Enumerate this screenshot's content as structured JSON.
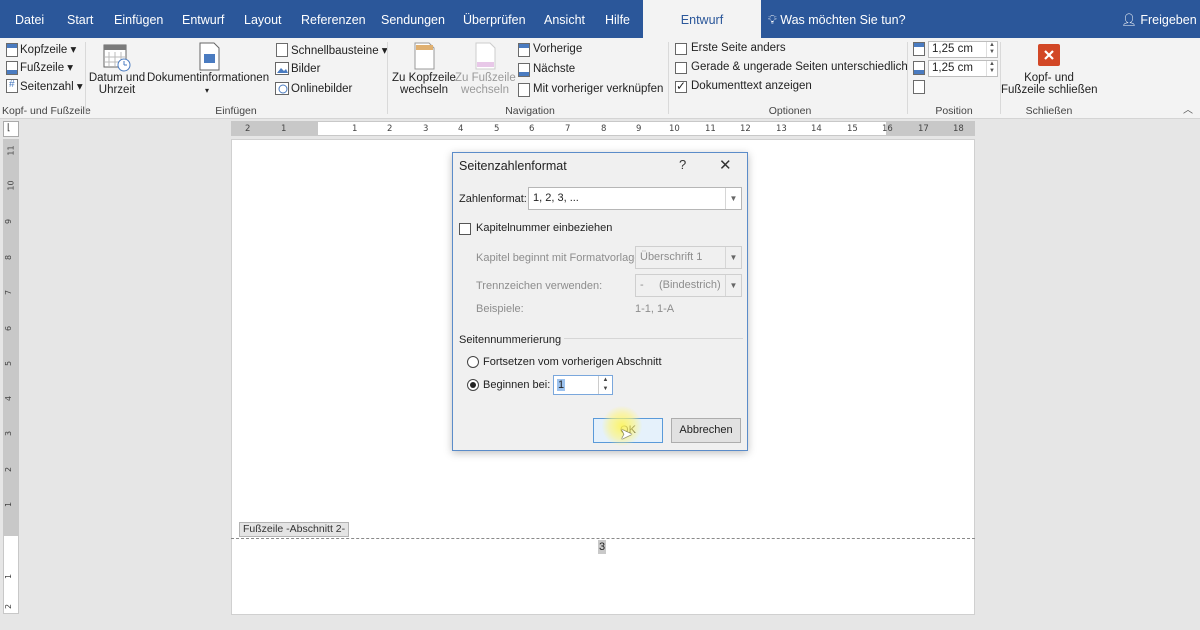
{
  "ribbon_tabs": [
    "Datei",
    "Start",
    "Einfügen",
    "Entwurf",
    "Layout",
    "Referenzen",
    "Sendungen",
    "Überprüfen",
    "Ansicht",
    "Hilfe"
  ],
  "active_tab": "Entwurf",
  "tell_me": "Was möchten Sie tun?",
  "share": "Freigeben",
  "groups": {
    "kopf": {
      "kopfzeile": "Kopfzeile",
      "fusszeile": "Fußzeile",
      "seitenzahl": "Seitenzahl",
      "label": "Kopf- und Fußzeile"
    },
    "einfuegen": {
      "datum_line1": "Datum und",
      "datum_line2": "Uhrzeit",
      "dokinfo": "Dokumentinformationen",
      "schnellbausteine": "Schnellbausteine",
      "bilder": "Bilder",
      "onlinebilder": "Onlinebilder",
      "label": "Einfügen"
    },
    "navigation": {
      "zu_kopf_line1": "Zu Kopfzeile",
      "zu_kopf_line2": "wechseln",
      "zu_fuss_line1": "Zu Fußzeile",
      "zu_fuss_line2": "wechseln",
      "vorherige": "Vorherige",
      "naechste": "Nächste",
      "verknuepfen": "Mit vorheriger verknüpfen",
      "label": "Navigation"
    },
    "optionen": {
      "erste_seite": "Erste Seite anders",
      "gerade": "Gerade & ungerade Seiten unterschiedlich",
      "doktext": "Dokumenttext anzeigen",
      "erste_checked": false,
      "gerade_checked": false,
      "doktext_checked": true,
      "label": "Optionen"
    },
    "position": {
      "top_value": "1,25 cm",
      "bottom_value": "1,25 cm",
      "label": "Position"
    },
    "schliessen": {
      "line1": "Kopf- und",
      "line2": "Fußzeile schließen",
      "label": "Schließen"
    }
  },
  "hruler_ticks": [
    "2",
    "1",
    "1",
    "2",
    "3",
    "4",
    "5",
    "6",
    "7",
    "8",
    "9",
    "10",
    "11",
    "12",
    "13",
    "14",
    "15",
    "16",
    "17",
    "18"
  ],
  "vruler_ticks": [
    "11",
    "10",
    "9",
    "8",
    "7",
    "6",
    "5",
    "4",
    "3",
    "2",
    "1",
    "1",
    "2"
  ],
  "document": {
    "footer_tag": "Fußzeile -Abschnitt 2-",
    "page_number": "3"
  },
  "dialog": {
    "title": "Seitenzahlenformat",
    "help": "?",
    "close": "✕",
    "zahlenformat_label": "Zahlenformat:",
    "zahlenformat_value": "1, 2, 3, ...",
    "kapitel_label": "Kapitelnummer einbeziehen",
    "kapitel_checked": false,
    "kapitel_beginnt_label": "Kapitel beginnt mit Formatvorlage:",
    "kapitel_beginnt_value": "Überschrift 1",
    "trennzeichen_label": "Trennzeichen verwenden:",
    "trennzeichen_value": "-     (Bindestrich)",
    "beispiele_label": "Beispiele:",
    "beispiele_value": "1-1, 1-A",
    "seitennummerierung_label": "Seitennummerierung",
    "fortsetzen_label": "Fortsetzen vom vorherigen Abschnitt",
    "beginnen_label": "Beginnen bei:",
    "beginnen_value": "1",
    "selected_option": "beginnen",
    "ok_label": "OK",
    "cancel_label": "Abbrechen"
  },
  "colors": {
    "ribbon_blue": "#2b579a",
    "close_red": "#d24726",
    "focus_blue": "#5a9ad9"
  }
}
